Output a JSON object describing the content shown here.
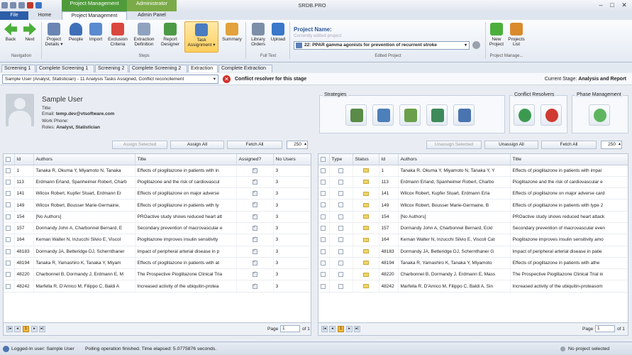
{
  "window": {
    "app_title": "SRDB.PRO",
    "context_project_management": "Project Management",
    "context_administrator": "Administrator",
    "controls": {
      "minimize": "–",
      "maximize": "□",
      "close": "✕"
    }
  },
  "ribbon_tabs": {
    "file": "File",
    "home": "Home",
    "project_management": "Project Management",
    "admin_panel": "Admin Panel"
  },
  "ribbon": {
    "navigation": {
      "back": "Back",
      "next": "Next",
      "group": "Navigation"
    },
    "steps": {
      "project_details": "Project Details ▾",
      "people": "People",
      "import": "Import",
      "exclusion_criteria": "Exclusion Criteria",
      "extraction_definition": "Extraction Definition",
      "report_designer": "Report Designer",
      "task_assignment": "Task Assignment ▾",
      "summary": "Summary",
      "group": "Steps"
    },
    "full_text": {
      "library_orders": "Library Orders",
      "upload": "Upload",
      "group": "Full Text"
    },
    "edited_project": {
      "label": "Project Name:",
      "subtitle": "Currently edited project",
      "value": "22: PPAR gamma agonists for prevention of recurrent stroke",
      "group": "Edited Project"
    },
    "project_manage": {
      "new_project": "New Project",
      "projects_list": "Projects List",
      "group": "Project Manage..."
    }
  },
  "stage_tabs": [
    "Screening 1",
    "Complete Screening 1",
    "Screening 2",
    "Complete Screening 2",
    "Extraction",
    "Complete Extraction"
  ],
  "active_stage_tab": 4,
  "user_bar": {
    "selected_user": "Sample User (Analyst, Statistician) - 11 Analysis Tasks Assigned, Conflict reconcilement",
    "conflict_text": "Conflict resolver for this stage",
    "stage_label": "Current Stage:",
    "stage_value": "Analysis and Report"
  },
  "user_info": {
    "name": "Sample User",
    "title": "Title:",
    "email_label": "Email:",
    "email": "temp.dev@vtsoftware.com",
    "work_phone": "Work Phone:",
    "roles_label": "Roles:",
    "roles": "Analyst, Statistician"
  },
  "panels": {
    "strategies": "Strategies",
    "conflict_resolvers": "Conflict Resolvers",
    "phase_management": "Phase Management"
  },
  "left_controls": {
    "assign_selected": "Assign Selected",
    "assign_all": "Assign All",
    "fetch_all": "Fetch All",
    "page_size": "250"
  },
  "right_controls": {
    "unassign_selected": "Unassign Selected",
    "unassign_all": "Unassign All",
    "fetch_all": "Fetch All",
    "page_size": "250"
  },
  "left_grid": {
    "headers": [
      "Id",
      "Authors",
      "Title",
      "Assigned?",
      "No Users"
    ],
    "rows": [
      [
        "1",
        "Tanaka R, Okuma Y, Miyamoto N, Tanaka",
        "Effects of pioglitazone in patients with in",
        "3"
      ],
      [
        "113",
        "Erdmann Erland, Spanheimer Robert, Charb",
        "Pioglitazone and the risk of cardiovascul",
        "3"
      ],
      [
        "141",
        "Wilcox Robert, Kupfer Stuart, Erdmann Er",
        "Effects of pioglitazone on major adverse",
        "3"
      ],
      [
        "149",
        "Wilcox Robert, Bousser Marie-Germaine,",
        "Effects of pioglitazone in patients with ty",
        "3"
      ],
      [
        "154",
        "[No Authors]",
        "PROactive study shows reduced heart att",
        "3"
      ],
      [
        "157",
        "Dormandy John A, Charbonnel Bernard, E",
        "Secondary prevention of macrovascular e",
        "3"
      ],
      [
        "164",
        "Kernan Walter N, Inzucchi Silvio E, Viscol",
        "Pioglitazone improves insulin sensitivity",
        "3"
      ],
      [
        "48183",
        "Dormandy JA, Betteridge DJ, Schernthaner",
        "Impact of peripheral arterial disease in p",
        "3"
      ],
      [
        "48194",
        "Tanaka R, Yamashiro K, Tanaka Y, Miyam",
        "Effects of pioglitazone in patients with at",
        "3"
      ],
      [
        "48220",
        "Charbonnel B, Dormandy J, Erdmann E, M",
        "The Prospective Pioglitazone Clinical Tria",
        "3"
      ],
      [
        "48242",
        "Marfella R, D'Amico M, Filippo C, Baldi A",
        "Increased activity of the ubiquitin-protea",
        "3"
      ]
    ]
  },
  "right_grid": {
    "headers": [
      "Type",
      "Status",
      "Id",
      "Authors",
      "Title"
    ],
    "rows": [
      [
        "1",
        "Tanaka R, Okuma Y, Miyamoto N, Tanaka Y, Y",
        "Effects of pioglitazone in patients with impai"
      ],
      [
        "113",
        "Erdmann Erland, Spanheimer Robert, Charbo",
        "Pioglitazone and the risk of cardiovascular e"
      ],
      [
        "141",
        "Wilcox Robert, Kupfer Stuart, Erdmann Erla",
        "Effects of pioglitazone on major adverse card"
      ],
      [
        "149",
        "Wilcox Robert, Bousser Marie-Germaine, B",
        "Effects of pioglitazone in patients with type 2"
      ],
      [
        "154",
        "[No Authors]",
        "PROactive study shows reduced heart attack"
      ],
      [
        "157",
        "Dormandy John A, Charbonnel Bernard, Eckl",
        "Secondary prevention of macrovascular even"
      ],
      [
        "164",
        "Kernan Walter N, Inzucchi Silvio E, Viscoli Cat",
        "Pioglitazone improves insulin sensitivity amo"
      ],
      [
        "48183",
        "Dormandy JA, Betteridge DJ, Schernthaner G",
        "Impact of peripheral arterial disease in patie"
      ],
      [
        "48194",
        "Tanaka R, Yamashiro K, Tanaka Y, Miyamoto",
        "Effects of pioglitazone in patients with athe"
      ],
      [
        "48220",
        "Charbonnel B, Dormandy J, Erdmann E, Mass",
        "The Prospective Pioglitazone Clinical Trial in"
      ],
      [
        "48242",
        "Marfella R, D'Amico M, Filippo C, Baldi A, Sin",
        "Increased activity of the ubiquitin-proteasom"
      ]
    ]
  },
  "pager": {
    "page_label": "Page",
    "page_value": "1",
    "of_label": "of 1",
    "current": "1"
  },
  "status_bar": {
    "logged_in": "Logged-In user: Sample User",
    "polling": "Polling operation finished. Time elapsed: 5.0775876 seconds.",
    "project": "No project selected"
  },
  "colors": {
    "accent": "#2b579a",
    "context_green": "#4f9b3a",
    "task_assignment": "#ffcf5c",
    "conflict_red": "#d0302a"
  }
}
